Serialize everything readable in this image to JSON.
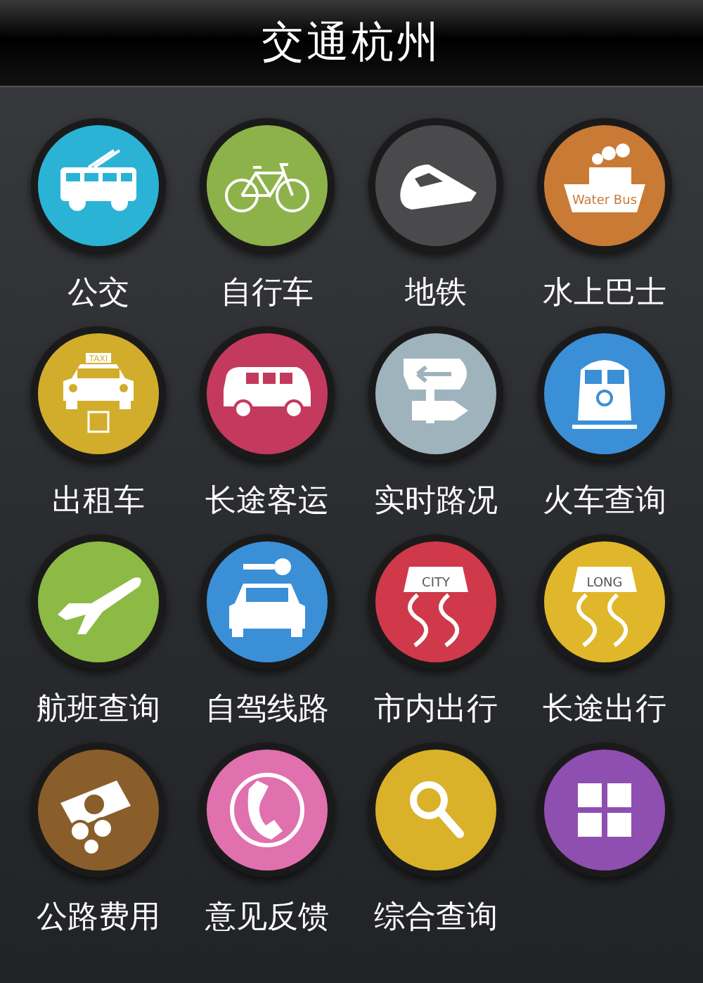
{
  "header": {
    "title": "交通杭州"
  },
  "items": [
    {
      "label": "公交",
      "color": "#2bb3d6",
      "kind": "bus"
    },
    {
      "label": "自行车",
      "color": "#8db24a",
      "kind": "bicycle"
    },
    {
      "label": "地铁",
      "color": "#4a4a4c",
      "kind": "train"
    },
    {
      "label": "水上巴士",
      "color": "#c97a34",
      "kind": "ship",
      "icon_text": "Water Bus"
    },
    {
      "label": "出租车",
      "color": "#d2ad2c",
      "kind": "taxi",
      "icon_text": "TAXI"
    },
    {
      "label": "长途客运",
      "color": "#c43a5e",
      "kind": "van"
    },
    {
      "label": "实时路况",
      "color": "#9fb3bd",
      "kind": "signpost"
    },
    {
      "label": "火车查询",
      "color": "#3b8fd6",
      "kind": "locomotive"
    },
    {
      "label": "航班查询",
      "color": "#8cba45",
      "kind": "plane"
    },
    {
      "label": "自驾线路",
      "color": "#3b8fd6",
      "kind": "car"
    },
    {
      "label": "市内出行",
      "color": "#d0394a",
      "kind": "road",
      "icon_text": "CITY"
    },
    {
      "label": "长途出行",
      "color": "#e0b62a",
      "kind": "road",
      "icon_text": "LONG"
    },
    {
      "label": "公路费用",
      "color": "#8a5e2a",
      "kind": "money"
    },
    {
      "label": "意见反馈",
      "color": "#e070ae",
      "kind": "phone"
    },
    {
      "label": "综合查询",
      "color": "#d9b22a",
      "kind": "search"
    },
    {
      "color": "#8e4fb0",
      "kind": "grid"
    }
  ]
}
